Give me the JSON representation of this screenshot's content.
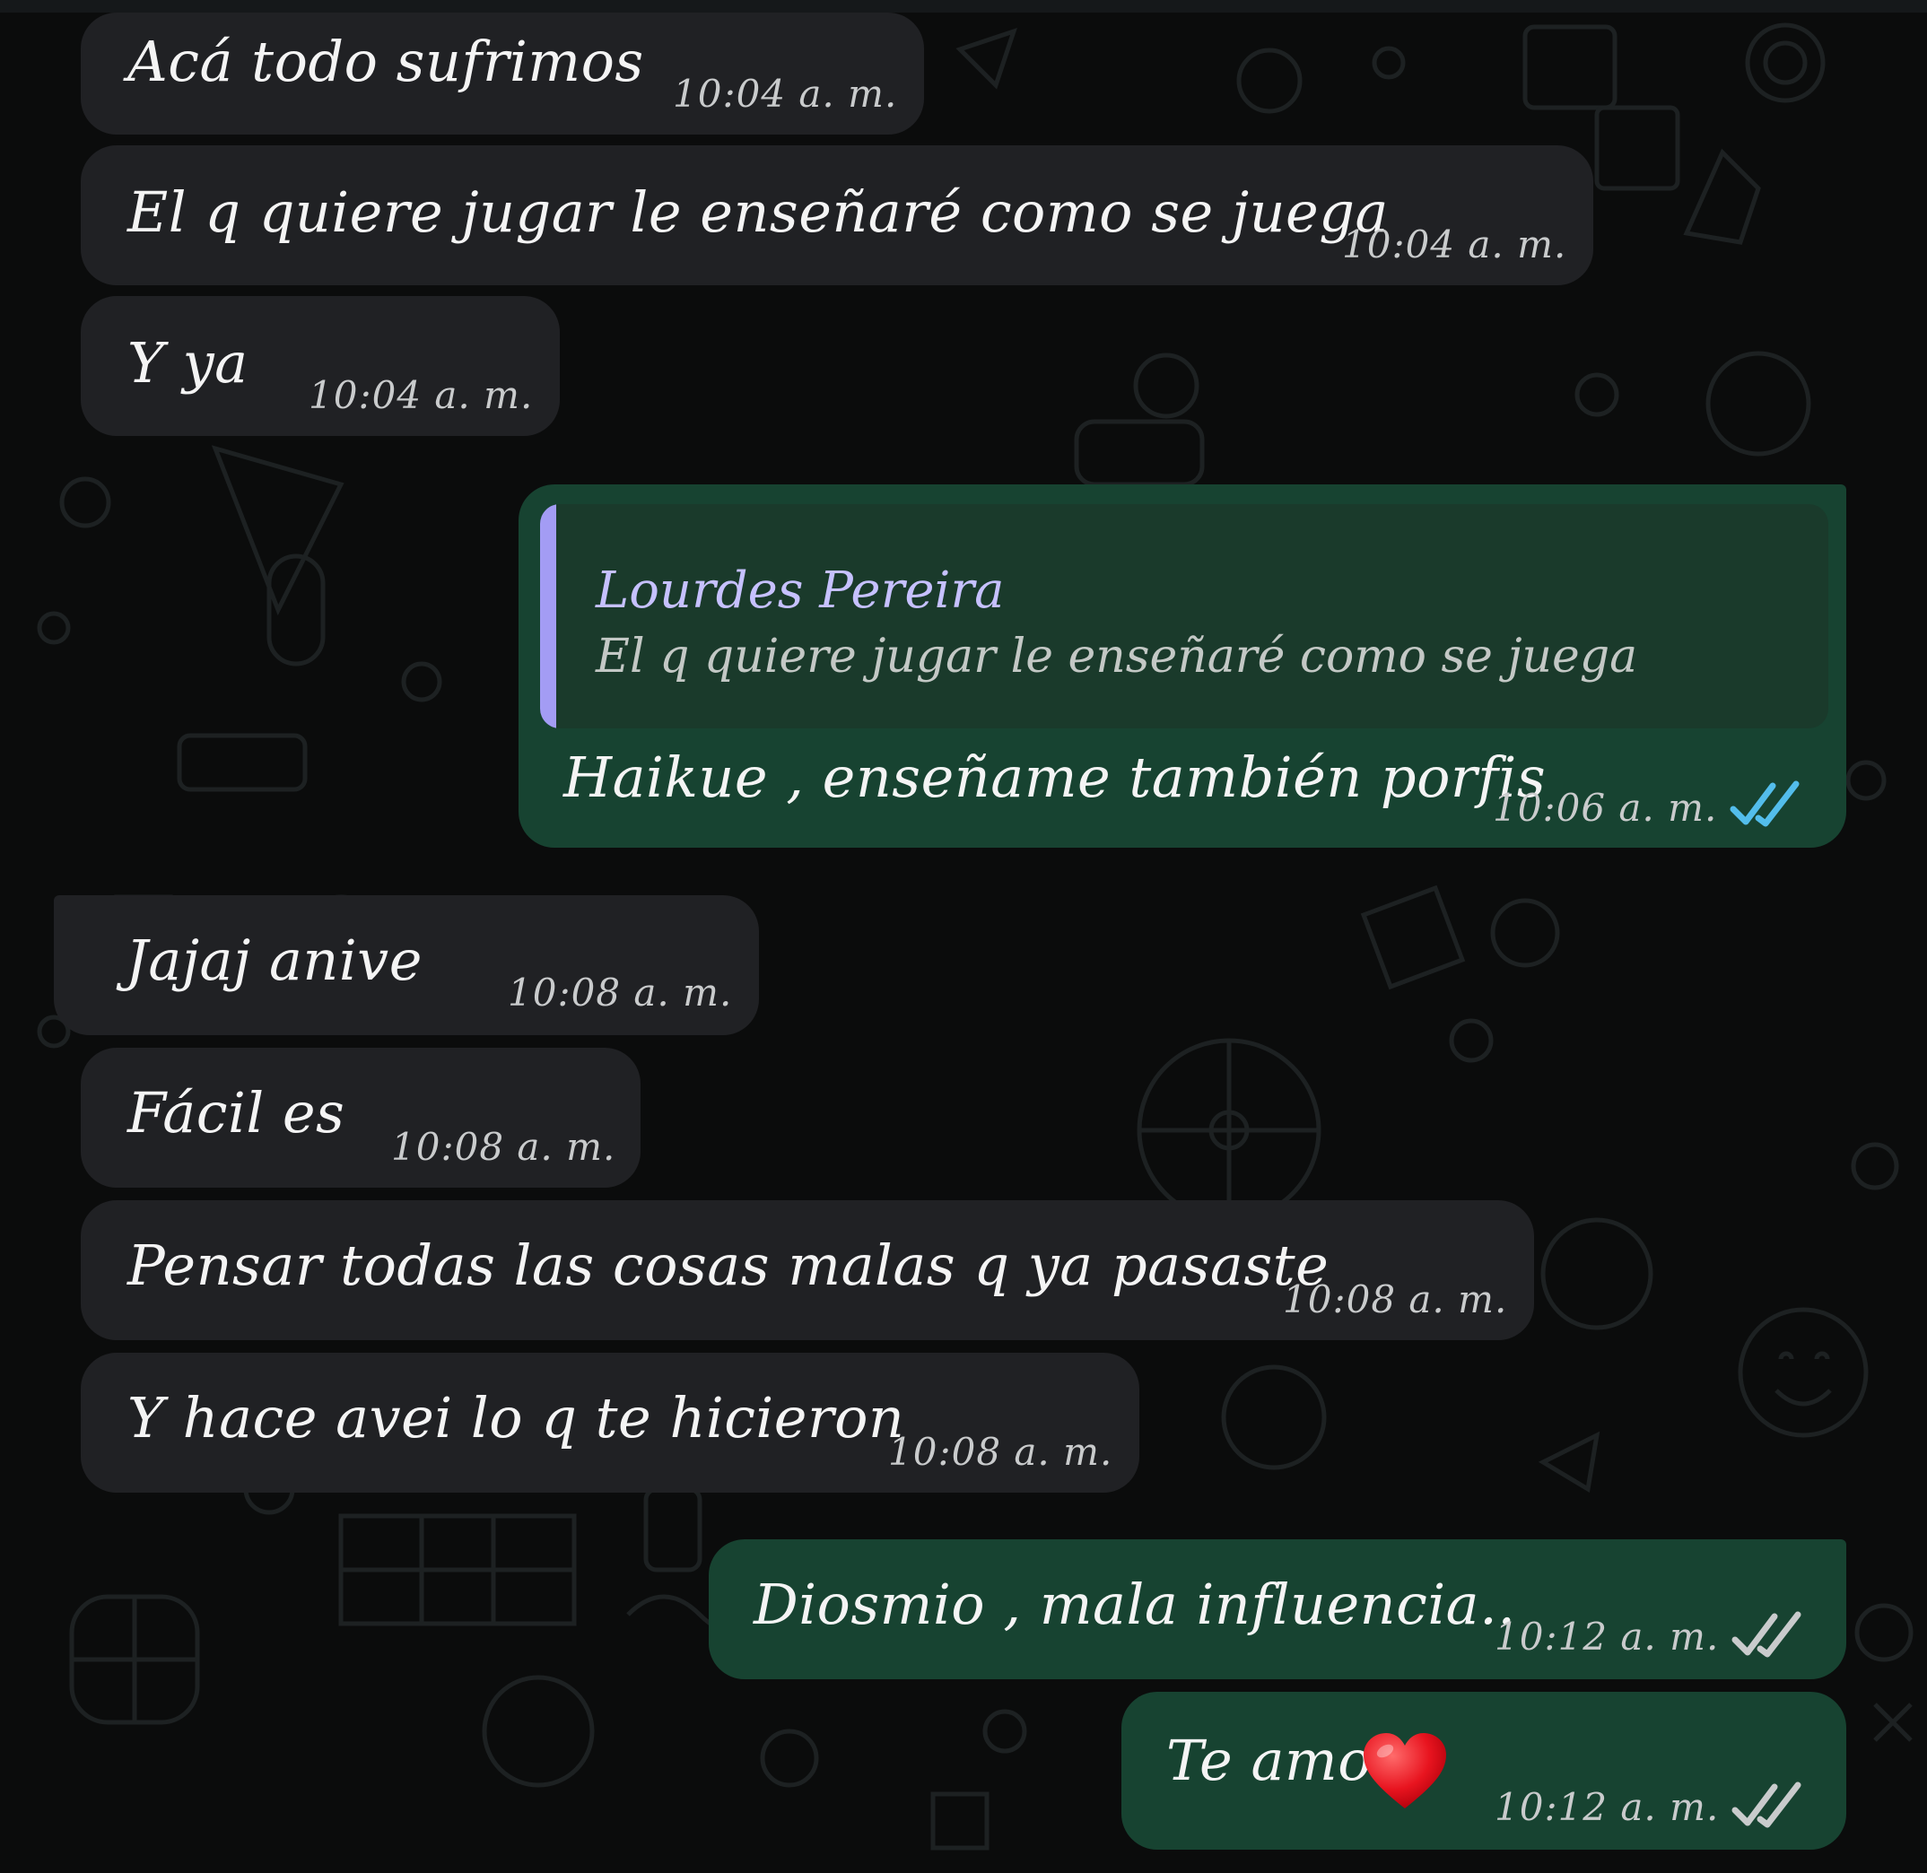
{
  "chat": {
    "messages": [
      {
        "text": "Acá todo sufrimos",
        "time": "10:04 a. m."
      },
      {
        "text": "El q quiere jugar le enseñaré como se juega",
        "time": "10:04 a. m."
      },
      {
        "text": "Y ya",
        "time": "10:04 a. m."
      },
      {
        "text": "Haikue , enseñame también porfis",
        "time": "10:06 a. m.",
        "quoted_author": "Lourdes Pereira",
        "quoted_text": "El q quiere jugar le enseñaré como se juega"
      },
      {
        "text": "Jajaj anive",
        "time": "10:08 a. m."
      },
      {
        "text": "Fácil es",
        "time": "10:08 a. m."
      },
      {
        "text": "Pensar todas las cosas malas q ya pasaste",
        "time": "10:08 a. m."
      },
      {
        "text": "Y hace avei lo q te hicieron",
        "time": "10:08 a. m."
      },
      {
        "text": "Diosmio , mala influencia..",
        "time": "10:12 a. m."
      },
      {
        "text": "Te amo",
        "time": "10:12 a. m.",
        "emoji": "heart"
      }
    ]
  },
  "colors": {
    "background": "#0b0c0c",
    "incoming_bubble": "#202124",
    "outgoing_bubble": "#174331",
    "read_ticks": "#53bdeb",
    "delivered_ticks": "#c9cbcc",
    "quote_accent": "#a39cf4"
  }
}
